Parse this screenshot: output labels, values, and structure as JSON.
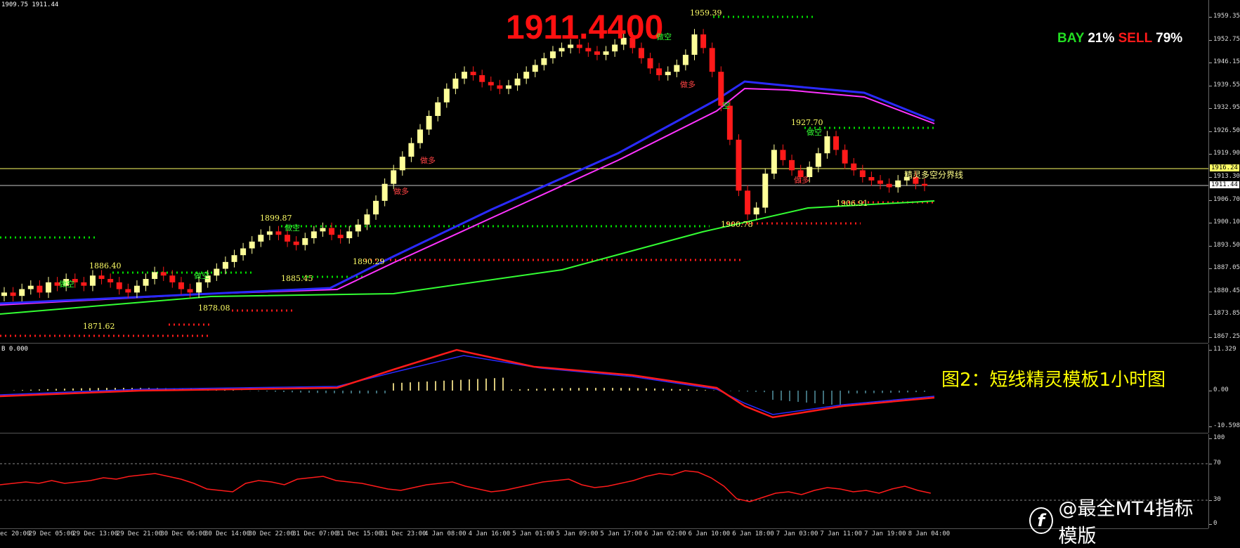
{
  "header": {
    "ohlc": "1909.75 1911.44"
  },
  "big_price": "1911.4400",
  "ratio": {
    "bay_label": "BAY",
    "bay_value": "21%",
    "sell_label": "SELL",
    "sell_value": "79%"
  },
  "price_axis": [
    "1959.35",
    "1952.75",
    "1946.15",
    "1939.55",
    "1932.95",
    "1926.50",
    "1919.90",
    "1913.30",
    "1906.70",
    "1900.10",
    "1893.50",
    "1887.05",
    "1880.45",
    "1873.85",
    "1867.25"
  ],
  "tags": {
    "yellow_line": "1916.24",
    "current": "1911.44"
  },
  "price_labels": {
    "p1": "1886.40",
    "p2": "1871.62",
    "p3": "1878.08",
    "p4": "1899.87",
    "p5": "1885.45",
    "p6": "1890.29",
    "p7": "1959.39",
    "p8": "1900.78",
    "p9": "1927.70",
    "p10": "1906.91"
  },
  "signals": {
    "short": "做空",
    "long": "做多",
    "short_b": "空"
  },
  "boundary_label": "精灵多空分界线",
  "macd": {
    "header": "B 0.000",
    "axis": [
      "11.329",
      "0.00",
      "-10.598"
    ]
  },
  "rsi": {
    "axis": [
      "100",
      "70",
      "30",
      "0"
    ]
  },
  "caption": "图2：短线精灵模板1小时图",
  "watermark": "@最全MT4指标模版",
  "time_axis": [
    "ec 20:00",
    "29 Dec 05:00",
    "29 Dec 13:00",
    "29 Dec 21:00",
    "30 Dec 06:00",
    "30 Dec 14:00",
    "30 Dec 22:00",
    "31 Dec 07:00",
    "31 Dec 15:00",
    "31 Dec 23:00",
    "4 Jan 08:00",
    "4 Jan 16:00",
    "5 Jan 01:00",
    "5 Jan 09:00",
    "5 Jan 17:00",
    "6 Jan 02:00",
    "6 Jan 10:00",
    "6 Jan 18:00",
    "7 Jan 03:00",
    "7 Jan 11:00",
    "7 Jan 19:00",
    "8 Jan 04:00"
  ],
  "colors": {
    "bull": "#ffff99",
    "bear": "#ff1a1a",
    "ema_blue": "#2a2aff",
    "ema_magenta": "#ff33ff",
    "ema_green": "#33ff33",
    "dots_green": "#00dd00",
    "dots_red": "#ff1a1a",
    "macd_line": "#ff1a1a",
    "macd_signal": "#2a2aff",
    "rsi_line": "#ff1a1a",
    "level_line": "#ffff66"
  },
  "chart_data": {
    "type": "candlestick",
    "symbol_timeframe": "H1",
    "close": [
      1880,
      1879,
      1881,
      1882,
      1880,
      1883,
      1882,
      1884,
      1883,
      1882,
      1885,
      1884,
      1883,
      1881,
      1880,
      1882,
      1884,
      1886,
      1885,
      1883,
      1881,
      1880,
      1883,
      1885,
      1887,
      1889,
      1891,
      1893,
      1895,
      1897,
      1898,
      1897,
      1895,
      1894,
      1896,
      1898,
      1899,
      1897,
      1896,
      1898,
      1900,
      1903,
      1907,
      1912,
      1916,
      1920,
      1924,
      1928,
      1932,
      1936,
      1940,
      1943,
      1945,
      1944,
      1942,
      1941,
      1940,
      1941,
      1943,
      1945,
      1947,
      1949,
      1951,
      1952,
      1953,
      1952,
      1951,
      1950,
      1951,
      1953,
      1955,
      1952,
      1949,
      1946,
      1944,
      1945,
      1947,
      1950,
      1956,
      1952,
      1945,
      1935,
      1925,
      1910,
      1903,
      1905,
      1915,
      1922,
      1919,
      1916,
      1914,
      1917,
      1921,
      1926,
      1922,
      1918,
      1916,
      1914,
      1913,
      1912,
      1911,
      1913,
      1914,
      1912,
      1911.44
    ],
    "ylim": [
      1867.25,
      1962.0
    ]
  }
}
